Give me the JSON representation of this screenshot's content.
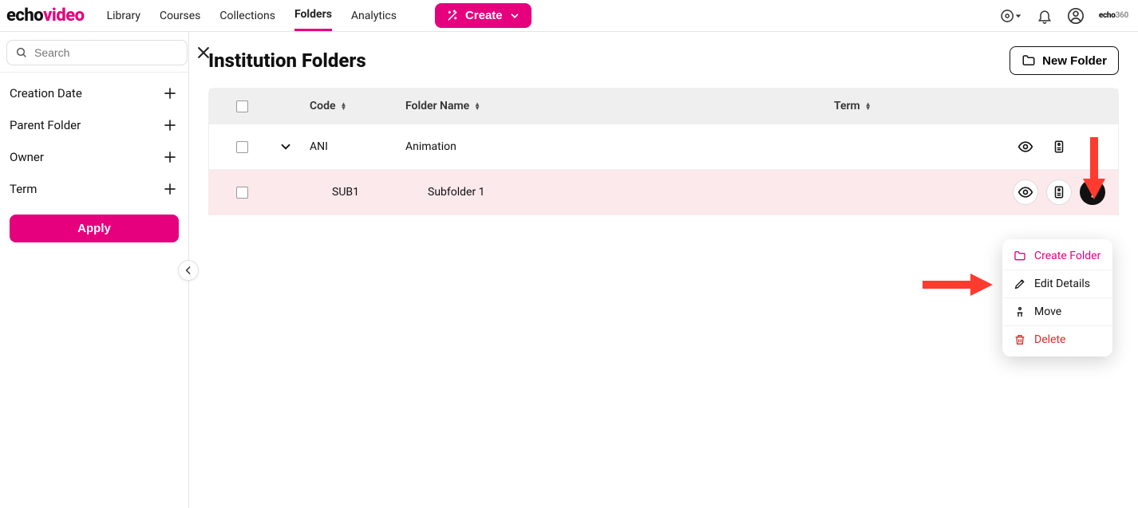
{
  "brand": {
    "part1": "echo",
    "part2": "video",
    "mini1": "echo",
    "mini2": "360"
  },
  "nav": {
    "items": [
      {
        "label": "Library"
      },
      {
        "label": "Courses"
      },
      {
        "label": "Collections"
      },
      {
        "label": "Folders",
        "active": true
      },
      {
        "label": "Analytics"
      }
    ],
    "create_label": "Create"
  },
  "sidebar": {
    "search_placeholder": "Search",
    "filters": [
      {
        "label": "Creation Date"
      },
      {
        "label": "Parent Folder"
      },
      {
        "label": "Owner"
      },
      {
        "label": "Term"
      }
    ],
    "apply_label": "Apply"
  },
  "page": {
    "title": "Institution Folders",
    "new_folder_label": "New Folder"
  },
  "table": {
    "headers": {
      "code": "Code",
      "name": "Folder Name",
      "term": "Term"
    },
    "rows": [
      {
        "code": "ANI",
        "name": "Animation",
        "term": "",
        "expandable": true
      },
      {
        "code": "SUB1",
        "name": "Subfolder 1",
        "term": "",
        "child": true
      }
    ]
  },
  "menu": {
    "create_folder": "Create Folder",
    "edit_details": "Edit Details",
    "move": "Move",
    "delete": "Delete"
  }
}
